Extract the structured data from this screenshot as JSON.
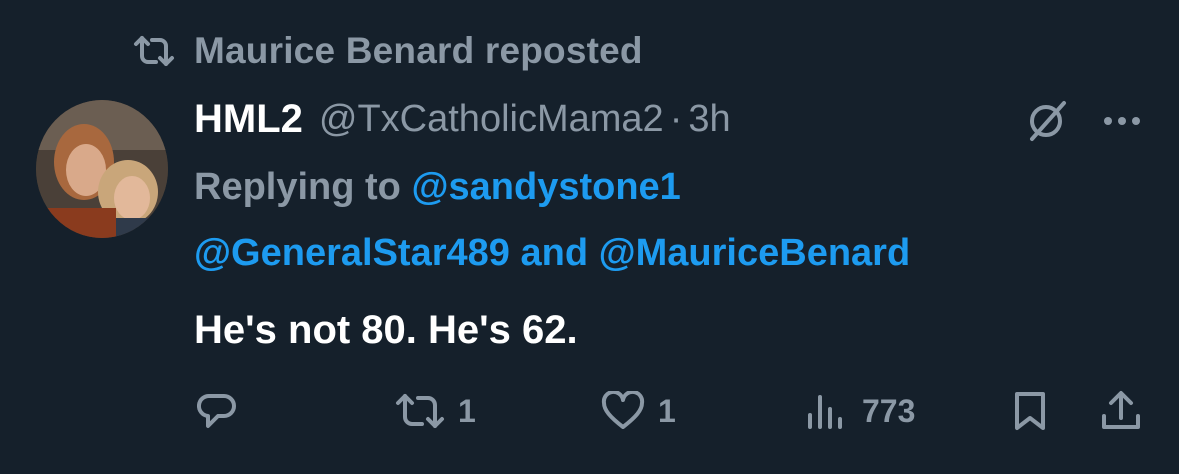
{
  "repost": {
    "icon": "repost-icon",
    "text": "Maurice Benard reposted"
  },
  "tweet": {
    "avatar": "avatar",
    "display_name": "HML2",
    "handle": "@TxCatholicMama2",
    "separator": "·",
    "time": "3h",
    "replying_label": "Replying to",
    "reply_to_1": "@sandystone1",
    "reply_to_2": "@GeneralStar489",
    "and_text": "and",
    "reply_to_3": "@MauriceBenard",
    "text": "He's not 80. He's 62."
  },
  "header_icons": {
    "grok": "grok-icon",
    "more": "more-options-icon"
  },
  "actions": {
    "reply": {
      "icon": "reply-icon",
      "count": ""
    },
    "repost": {
      "icon": "repost-icon",
      "count": "1"
    },
    "like": {
      "icon": "like-icon",
      "count": "1"
    },
    "views": {
      "icon": "views-icon",
      "count": "773"
    },
    "bookmark": {
      "icon": "bookmark-icon"
    },
    "share": {
      "icon": "share-icon"
    }
  },
  "colors": {
    "background": "#15202b",
    "muted": "#8b98a5",
    "accent": "#1d9bf0",
    "text": "#ffffff"
  }
}
